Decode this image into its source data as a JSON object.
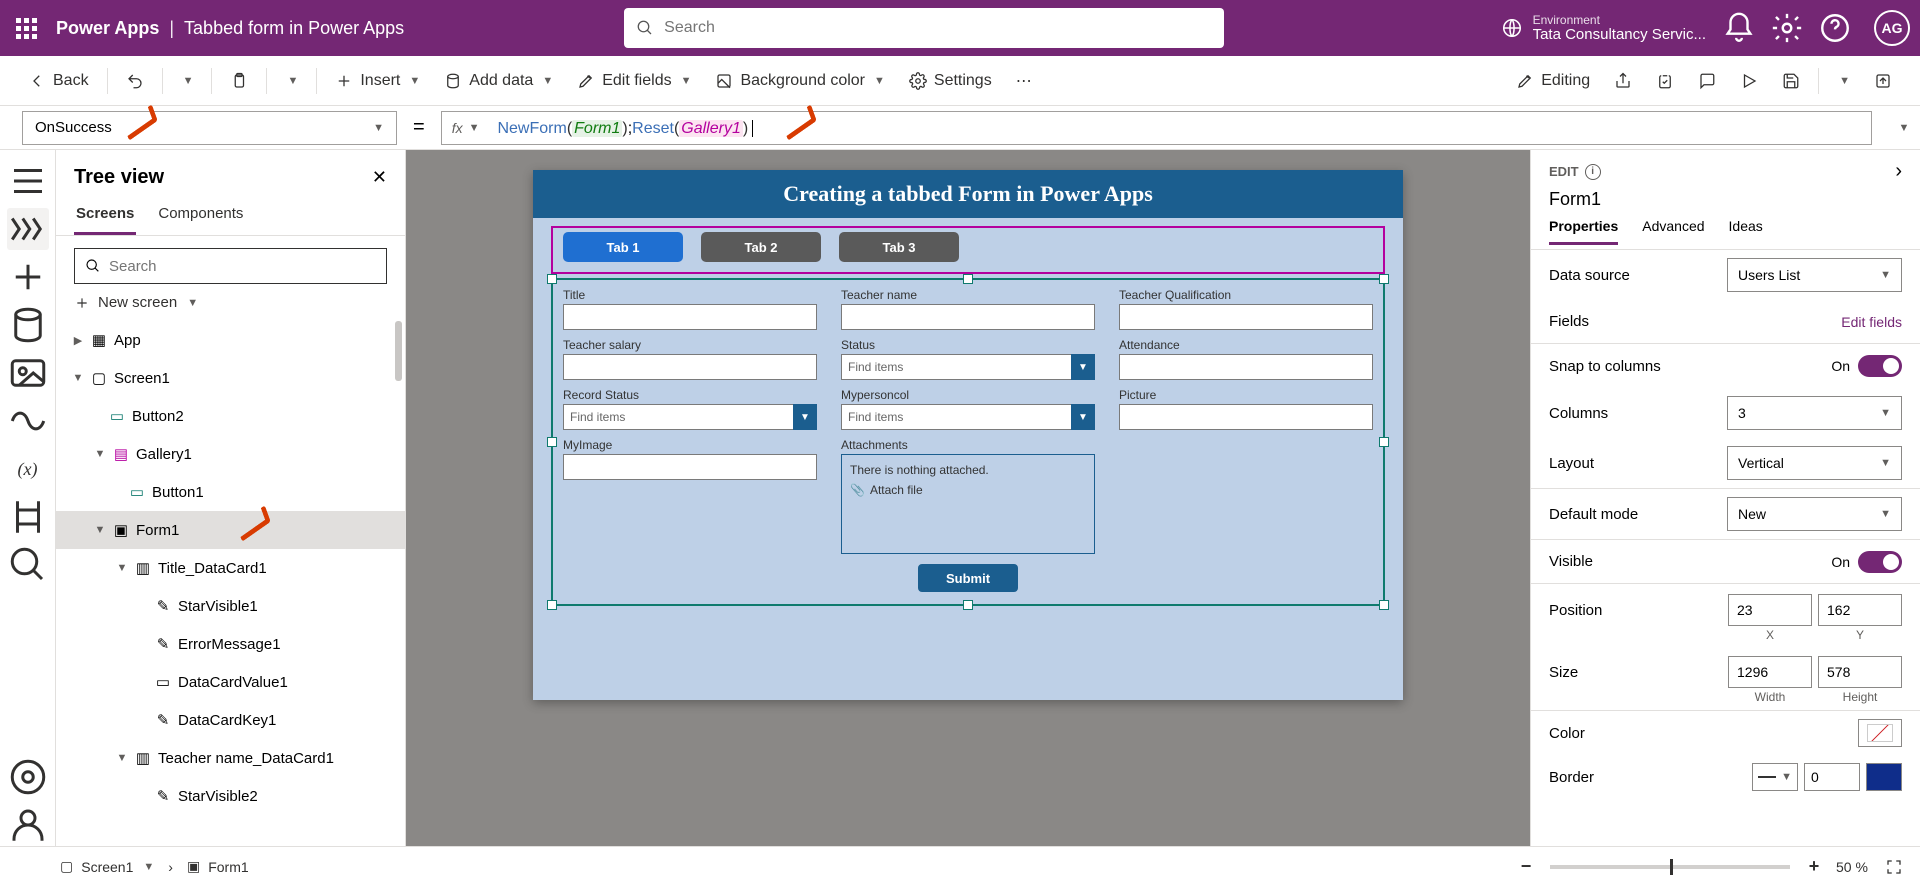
{
  "header": {
    "brand": "Power Apps",
    "separator": "|",
    "appTitle": "Tabbed form in Power Apps",
    "searchPlaceholder": "Search",
    "environmentLabel": "Environment",
    "environmentName": "Tata Consultancy Servic...",
    "avatar": "AG"
  },
  "cmd": {
    "back": "Back",
    "insert": "Insert",
    "addData": "Add data",
    "editFields": "Edit fields",
    "bgColor": "Background color",
    "settings": "Settings",
    "editing": "Editing"
  },
  "formulaBar": {
    "property": "OnSuccess",
    "fx": "fx",
    "kw1": "NewForm",
    "arg1": "Form1",
    "sep": ";",
    "kw2": "Reset",
    "arg2": "Gallery1"
  },
  "treeView": {
    "title": "Tree view",
    "tabs": {
      "screens": "Screens",
      "components": "Components"
    },
    "searchPlaceholder": "Search",
    "newScreen": "New screen",
    "items": {
      "app": "App",
      "screen1": "Screen1",
      "button2": "Button2",
      "gallery1": "Gallery1",
      "button1": "Button1",
      "form1": "Form1",
      "titleCard": "Title_DataCard1",
      "starVisible1": "StarVisible1",
      "errorMessage1": "ErrorMessage1",
      "dataCardValue1": "DataCardValue1",
      "dataCardKey1": "DataCardKey1",
      "teacherNameCard": "Teacher name_DataCard1",
      "starVisible2": "StarVisible2"
    }
  },
  "canvas": {
    "heading": "Creating a tabbed Form in Power Apps",
    "tabs": {
      "t1": "Tab 1",
      "t2": "Tab 2",
      "t3": "Tab 3"
    },
    "fields": {
      "title": "Title",
      "teacherName": "Teacher name",
      "teacherQual": "Teacher Qualification",
      "teacherSalary": "Teacher salary",
      "status": "Status",
      "attendance": "Attendance",
      "recordStatus": "Record Status",
      "mypersoncol": "Mypersoncol",
      "picture": "Picture",
      "myImage": "MyImage",
      "attachments": "Attachments",
      "findItems": "Find items",
      "attachNone": "There is nothing attached.",
      "attachFile": "Attach file",
      "submit": "Submit"
    }
  },
  "props": {
    "editLabel": "EDIT",
    "controlName": "Form1",
    "tabs": {
      "properties": "Properties",
      "advanced": "Advanced",
      "ideas": "Ideas"
    },
    "dataSourceLabel": "Data source",
    "dataSourceValue": "Users List",
    "fieldsLabel": "Fields",
    "editFieldsLink": "Edit fields",
    "snapLabel": "Snap to columns",
    "columnsLabel": "Columns",
    "columnsValue": "3",
    "layoutLabel": "Layout",
    "layoutValue": "Vertical",
    "defaultModeLabel": "Default mode",
    "defaultModeValue": "New",
    "visibleLabel": "Visible",
    "positionLabel": "Position",
    "positionX": "23",
    "positionY": "162",
    "xLabel": "X",
    "yLabel": "Y",
    "sizeLabel": "Size",
    "sizeW": "1296",
    "sizeH": "578",
    "wLabel": "Width",
    "hLabel": "Height",
    "colorLabel": "Color",
    "borderLabel": "Border",
    "borderValue": "0",
    "toggleOn": "On"
  },
  "status": {
    "screenIconLabel": "Screen1",
    "formLabel": "Form1",
    "zoomMinus": "−",
    "zoomPlus": "+",
    "zoomValue": "50",
    "zoomPercent": "%"
  }
}
